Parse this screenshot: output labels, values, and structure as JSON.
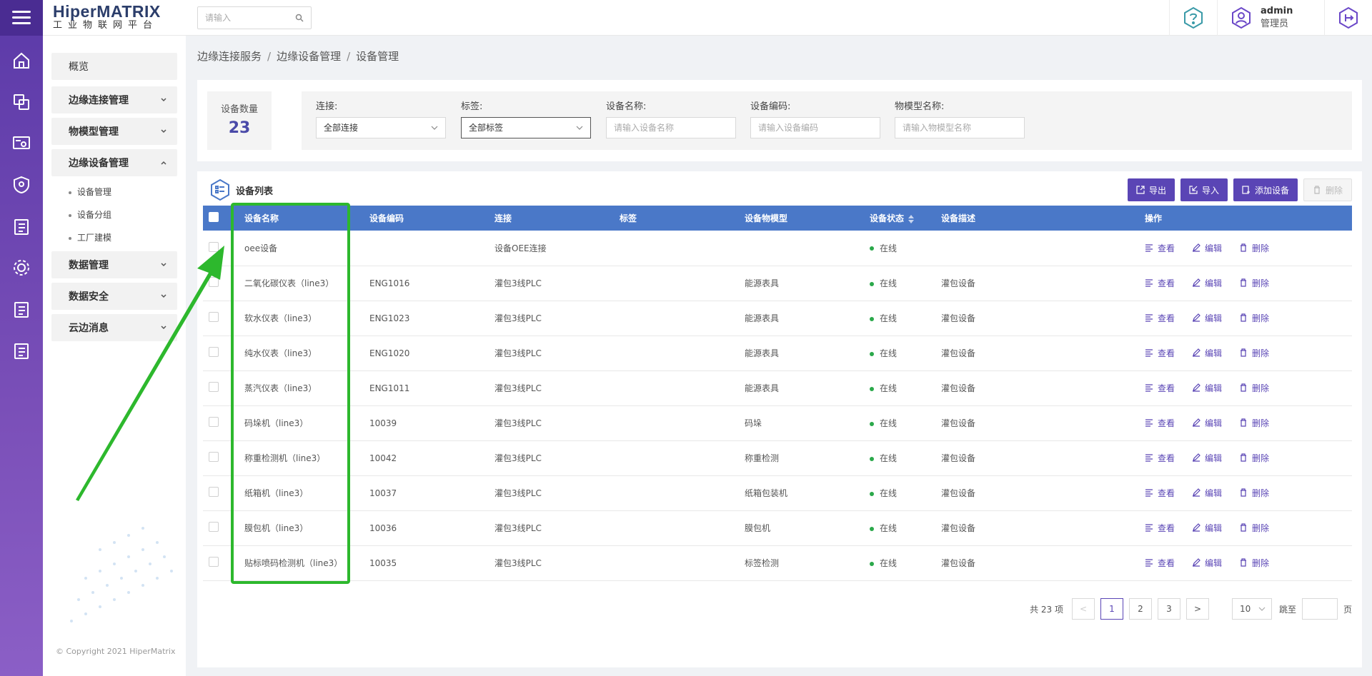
{
  "header": {
    "brand_main": "HiperMATRIX",
    "brand_sub": "工业物联网平台",
    "search_placeholder": "请输入",
    "user_name": "admin",
    "user_role": "管理员",
    "icons": [
      "help-icon",
      "user-icon",
      "logout-icon"
    ]
  },
  "rail": {
    "icons": [
      "home-icon",
      "device-link-icon",
      "monitor-eye-icon",
      "shield-icon",
      "clipboard-icon",
      "gear-icon",
      "clipboard-icon",
      "clipboard-icon"
    ]
  },
  "sidebar": {
    "overview": "概览",
    "items": [
      {
        "label": "边缘连接管理"
      },
      {
        "label": "物模型管理"
      },
      {
        "label": "边缘设备管理"
      },
      {
        "label": "数据管理"
      },
      {
        "label": "数据安全"
      },
      {
        "label": "云边消息"
      }
    ],
    "sub_items": [
      "设备管理",
      "设备分组",
      "工厂建模"
    ],
    "copyright": "© Copyright 2021 HiperMatrix"
  },
  "breadcrumb": [
    "边缘连接服务",
    "边缘设备管理",
    "设备管理"
  ],
  "summary": {
    "label": "设备数量",
    "count": "23"
  },
  "filters": {
    "connection": {
      "label": "连接:",
      "value": "全部连接"
    },
    "tag": {
      "label": "标签:",
      "value": "全部标签"
    },
    "device_name": {
      "label": "设备名称:",
      "placeholder": "请输入设备名称"
    },
    "device_code": {
      "label": "设备编码:",
      "placeholder": "请输入设备编码"
    },
    "model_name": {
      "label": "物模型名称:",
      "placeholder": "请输入物模型名称"
    }
  },
  "list": {
    "title": "设备列表",
    "buttons": {
      "export": "导出",
      "import": "导入",
      "add": "添加设备",
      "delete": "删除"
    },
    "columns": [
      "设备名称",
      "设备编码",
      "连接",
      "标签",
      "设备物模型",
      "设备状态",
      "设备描述",
      "操作"
    ],
    "actions": {
      "view": "查看",
      "edit": "编辑",
      "delete": "删除"
    },
    "rows": [
      {
        "name": "oee设备",
        "code": "",
        "conn": "设备OEE连接",
        "tag": "",
        "model": "",
        "status": "在线",
        "desc": ""
      },
      {
        "name": "二氧化碳仪表（line3）",
        "code": "ENG1016",
        "conn": "灌包3线PLC",
        "tag": "",
        "model": "能源表具",
        "status": "在线",
        "desc": "灌包设备"
      },
      {
        "name": "软水仪表（line3）",
        "code": "ENG1023",
        "conn": "灌包3线PLC",
        "tag": "",
        "model": "能源表具",
        "status": "在线",
        "desc": "灌包设备"
      },
      {
        "name": "纯水仪表（line3）",
        "code": "ENG1020",
        "conn": "灌包3线PLC",
        "tag": "",
        "model": "能源表具",
        "status": "在线",
        "desc": "灌包设备"
      },
      {
        "name": "蒸汽仪表（line3）",
        "code": "ENG1011",
        "conn": "灌包3线PLC",
        "tag": "",
        "model": "能源表具",
        "status": "在线",
        "desc": "灌包设备"
      },
      {
        "name": "码垛机（line3）",
        "code": "10039",
        "conn": "灌包3线PLC",
        "tag": "",
        "model": "码垛",
        "status": "在线",
        "desc": "灌包设备"
      },
      {
        "name": "称重检测机（line3）",
        "code": "10042",
        "conn": "灌包3线PLC",
        "tag": "",
        "model": "称重检测",
        "status": "在线",
        "desc": "灌包设备"
      },
      {
        "name": "纸箱机（line3）",
        "code": "10037",
        "conn": "灌包3线PLC",
        "tag": "",
        "model": "纸箱包装机",
        "status": "在线",
        "desc": "灌包设备"
      },
      {
        "name": "膜包机（line3）",
        "code": "10036",
        "conn": "灌包3线PLC",
        "tag": "",
        "model": "膜包机",
        "status": "在线",
        "desc": "灌包设备"
      },
      {
        "name": "贴标喷码检测机（line3）",
        "code": "10035",
        "conn": "灌包3线PLC",
        "tag": "",
        "model": "标签检测",
        "status": "在线",
        "desc": "灌包设备"
      }
    ]
  },
  "pagination": {
    "total": "共 23 项",
    "pages": [
      "1",
      "2",
      "3"
    ],
    "current": "1",
    "page_size": "10",
    "jump_label": "跳至",
    "page_suffix": "页",
    "prev": "<",
    "next": ">"
  },
  "colors": {
    "accent": "#5a45b5",
    "table_header": "#4a78c8",
    "status_online": "#2aa84a",
    "annotation": "#2db82d"
  }
}
